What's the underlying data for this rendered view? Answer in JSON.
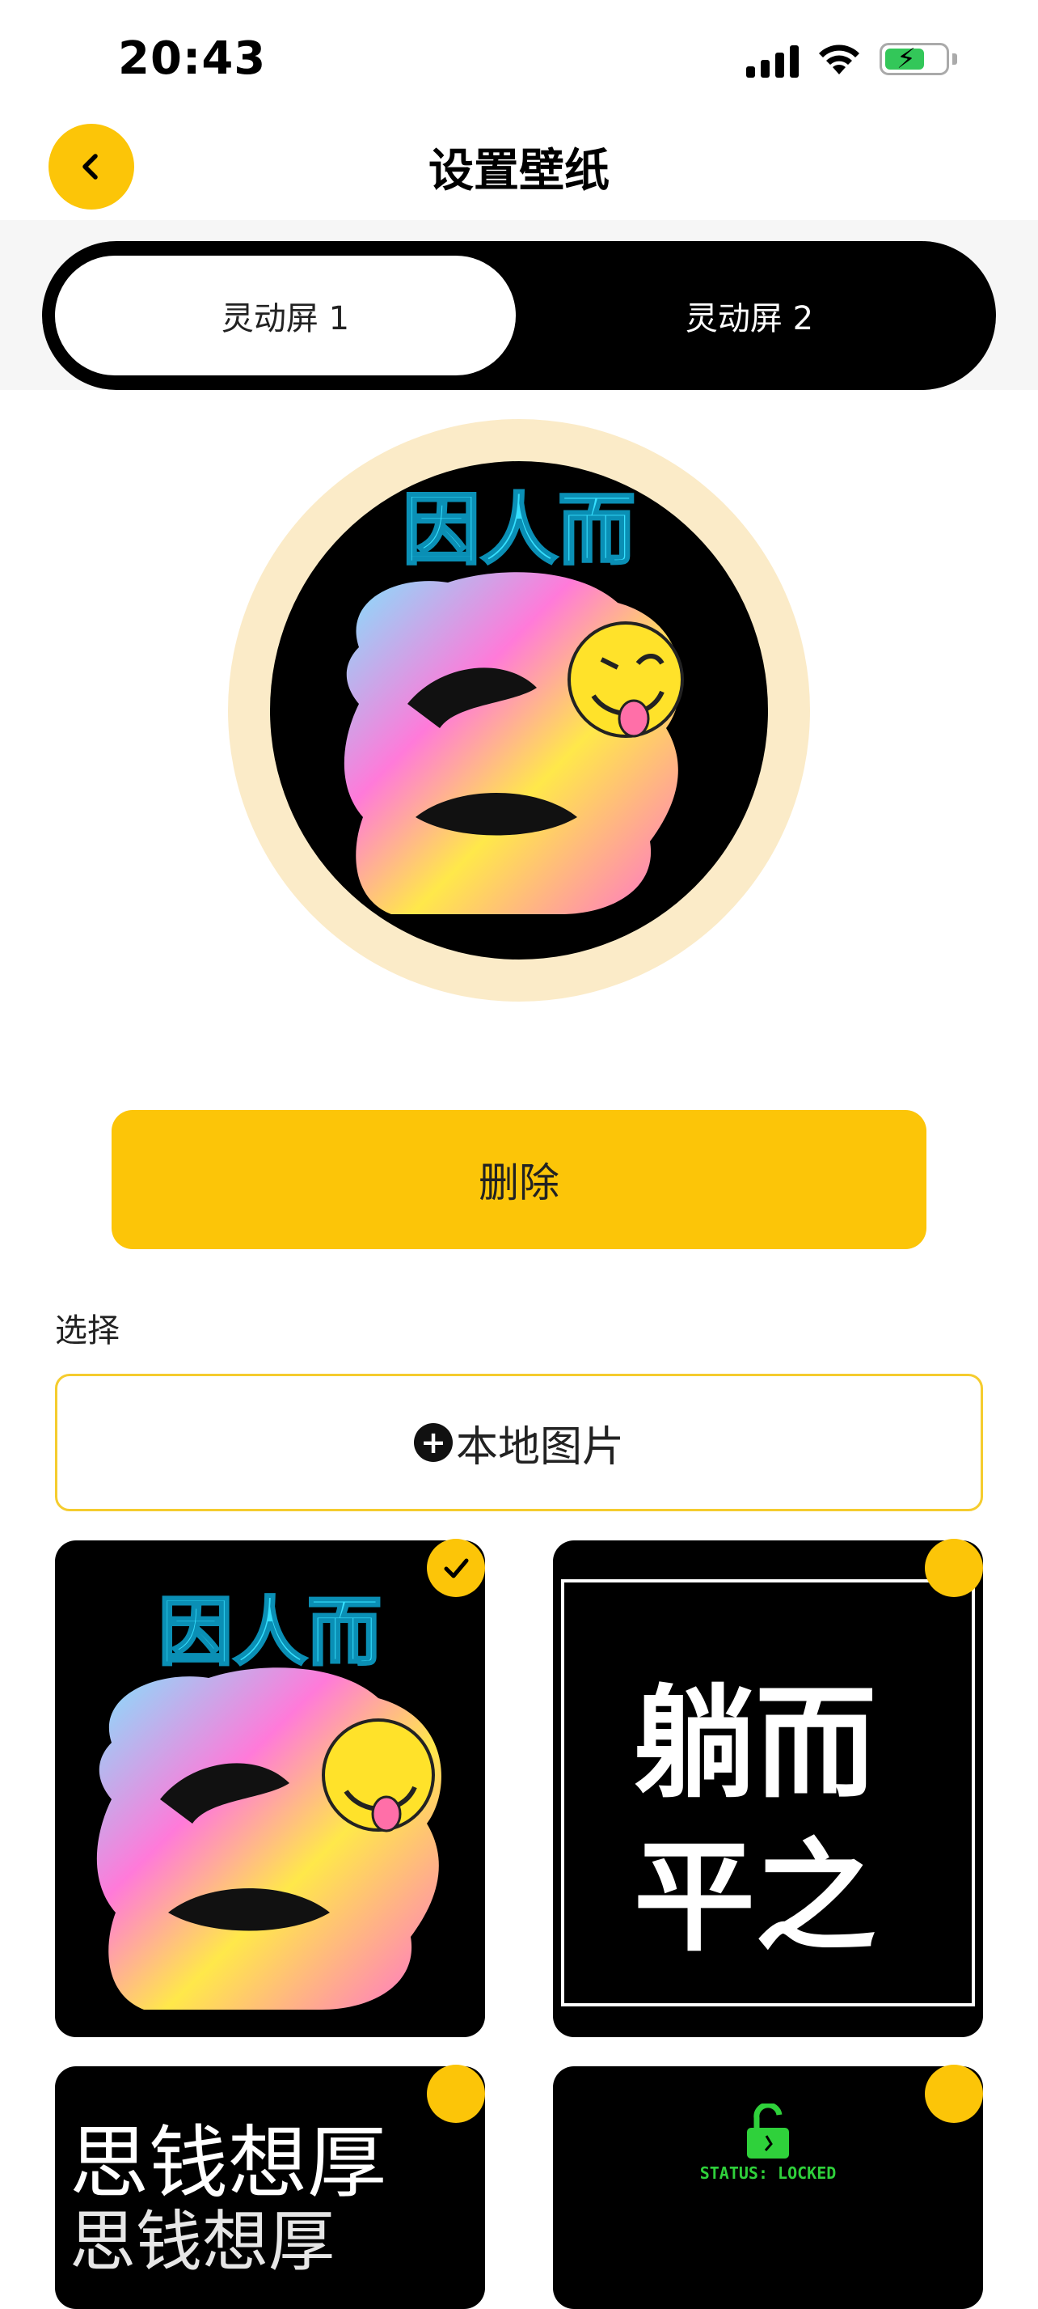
{
  "status_bar": {
    "time": "20:43"
  },
  "header": {
    "title": "设置壁纸",
    "back_icon": "chevron-left-icon"
  },
  "tabs": [
    {
      "label": "灵动屏 1",
      "active": true
    },
    {
      "label": "灵动屏 2",
      "active": false
    }
  ],
  "preview": {
    "caption": "因人而"
  },
  "actions": {
    "delete_label": "删除"
  },
  "select_section": {
    "label": "选择",
    "local_image_label": "本地图片"
  },
  "wallpapers": [
    {
      "caption": "因人而",
      "selected": true
    },
    {
      "line1": "躺而",
      "line2": "平之",
      "selected": false
    },
    {
      "line1": "思钱想厚",
      "line2": "思钱想厚",
      "selected": false
    },
    {
      "status": "STATUS: LOCKED",
      "selected": false
    }
  ],
  "colors": {
    "accent": "#fcc508",
    "ring": "#fbebc8",
    "lock_green": "#2fd13b"
  }
}
